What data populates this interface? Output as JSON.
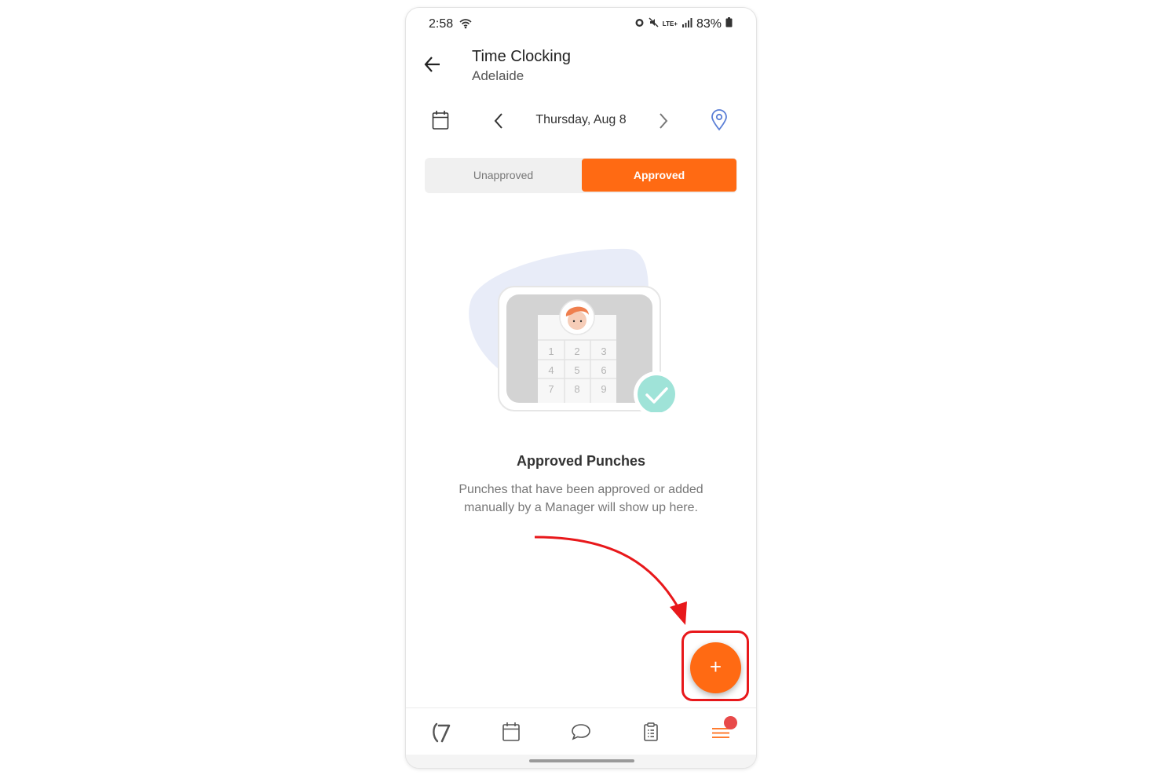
{
  "status_bar": {
    "time": "2:58",
    "network_label": "LTE+",
    "battery": "83%"
  },
  "header": {
    "title": "Time Clocking",
    "subtitle": "Adelaide"
  },
  "date_nav": {
    "date": "Thursday, Aug 8"
  },
  "tabs": [
    {
      "label": "Unapproved",
      "active": false
    },
    {
      "label": "Approved",
      "active": true
    }
  ],
  "illustration": {
    "keypad": [
      "1",
      "2",
      "3",
      "4",
      "5",
      "6",
      "7",
      "8",
      "9"
    ]
  },
  "empty_state": {
    "title": "Approved Punches",
    "description": "Punches that have been approved or added manually by a Manager will show up here."
  },
  "fab": {
    "label": "+"
  },
  "bottom_nav": {
    "items": [
      "home-logo-icon",
      "calendar-icon",
      "chat-bubble-icon",
      "clipboard-icon",
      "menu-icon"
    ],
    "menu_badge": true
  },
  "colors": {
    "accent": "#ff6a13",
    "highlight": "#e8181b",
    "check": "#5fd3bd",
    "location_icon": "#5b7fd6"
  }
}
